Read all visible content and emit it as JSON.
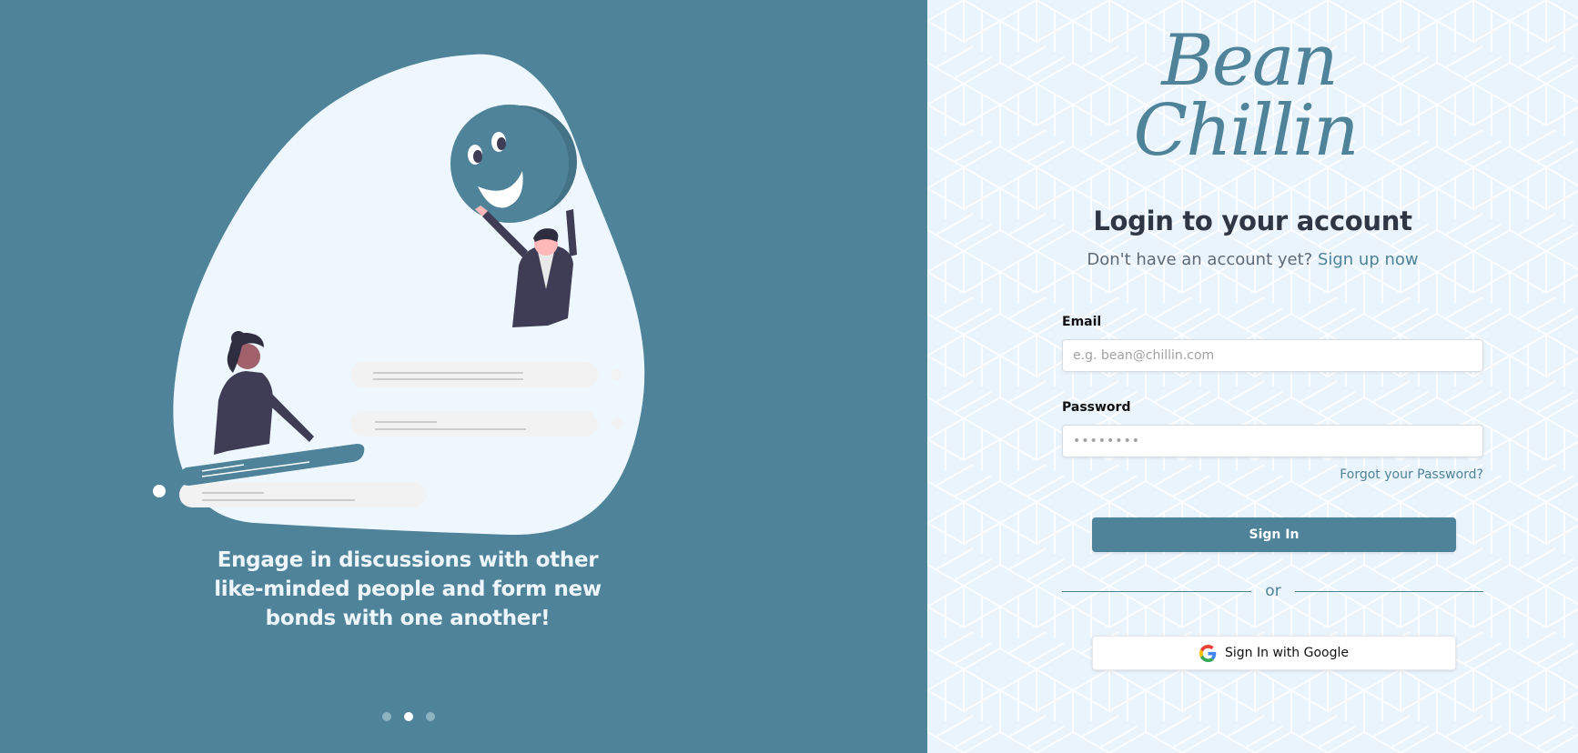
{
  "carousel": {
    "caption": "Engage in discussions with other like-minded people and form new bonds with one another!",
    "dots": [
      "1",
      "2",
      "3"
    ],
    "active_index": 1
  },
  "logo": {
    "line1": "Bean",
    "line2": "Chillin"
  },
  "login": {
    "title": "Login to your account",
    "signup_prompt": "Don't have an account yet?",
    "signup_link": "Sign up now"
  },
  "form": {
    "email_label": "Email",
    "email_placeholder": "e.g. bean@chillin.com",
    "password_label": "Password",
    "password_placeholder": "••••••••",
    "forgot_link": "Forgot your Password?",
    "signin_button": "Sign In",
    "divider_text": "or",
    "google_button": "Sign In with Google"
  },
  "colors": {
    "brand": "#4e8399",
    "left_background": "#4e8399",
    "right_background": "#eaf4fc",
    "title_text": "#2f3745"
  },
  "icons": {
    "google": "google-icon"
  }
}
